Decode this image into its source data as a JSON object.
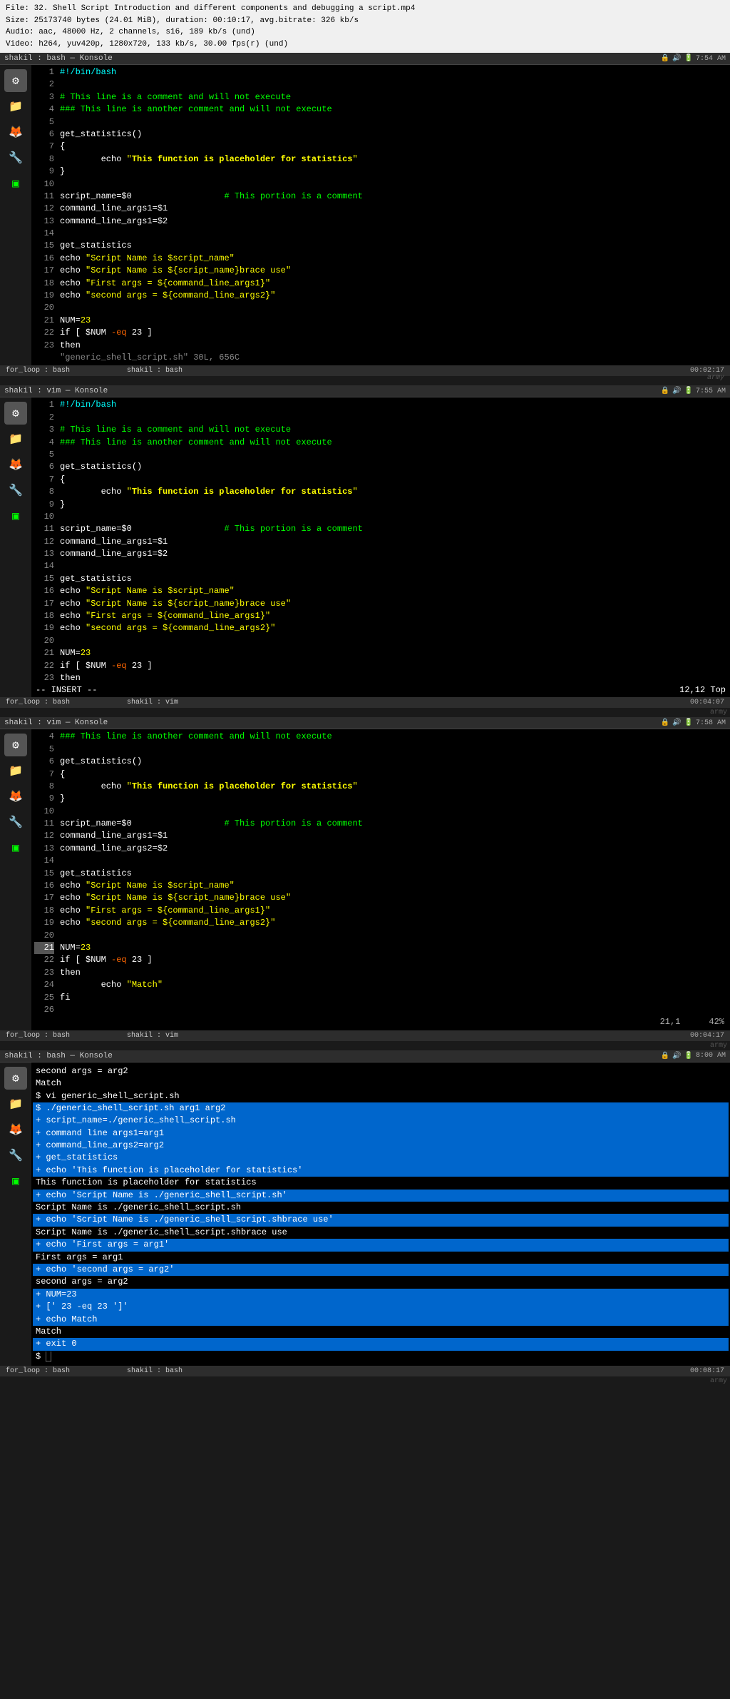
{
  "video": {
    "line1": "File: 32. Shell Script Introduction and different components and debugging a script.mp4",
    "line2": "Size: 25173740 bytes (24.01 MiB), duration: 00:10:17, avg.bitrate: 326 kb/s",
    "line3": "Audio: aac, 48000 Hz, 2 channels, s16, 189 kb/s (und)",
    "line4": "Video: h264, yuv420p, 1280x720, 133 kb/s, 30.00 fps(r) (und)"
  },
  "panels": [
    {
      "id": "panel1",
      "titlebar": "shakil : bash — Konsole",
      "timestamp": "7:54 AM",
      "mode": "bash",
      "statusbar_left": "for_loop : bash",
      "statusbar_right": "shakil : bash",
      "duration": "00:02:17"
    },
    {
      "id": "panel2",
      "titlebar": "shakil : vim — Konsole",
      "timestamp": "7:55 AM",
      "mode": "vim",
      "statusbar_left": "for_loop : bash",
      "statusbar_right": "shakil : vim",
      "duration": "00:04:07",
      "insert_mode": "-- INSERT --",
      "cursor_pos": "12,12",
      "scroll_pos": "Top"
    },
    {
      "id": "panel3",
      "titlebar": "shakil : vim — Konsole",
      "timestamp": "7:58 AM",
      "mode": "vim",
      "statusbar_left": "for_loop : bash",
      "statusbar_right": "shakil : vim",
      "duration": "00:04:17",
      "cursor_pos": "21,1",
      "scroll_pos": "42%"
    },
    {
      "id": "panel4",
      "titlebar": "shakil : bash — Konsole",
      "timestamp": "8:00 AM",
      "mode": "bash",
      "statusbar_left": "for_loop : bash",
      "statusbar_right": "shakil : bash",
      "duration": "00:08:17"
    }
  ],
  "code_block": {
    "shebang": "#!/bin/bash",
    "comment1": "# This line is a comment and will not execute",
    "comment2": "### This line is another comment and will not execute",
    "func_def": "get_statistics()",
    "brace_open": "{",
    "echo_func": "        echo \"This function is placeholder for statistics\"",
    "brace_close": "}",
    "script_name": "script_name=$0                  # This portion is a comment",
    "args1": "command_line_args1=$1",
    "args2": "command_line_args1=$2",
    "get_stats": "get_statistics",
    "echo1": "echo \"Script Name is $script_name\"",
    "echo2": "echo \"Script Name is ${script_name}brace use\"",
    "echo3": "echo \"First args = ${command_line_args1}\"",
    "echo4": "echo \"second args = ${command_line_args2}\"",
    "num": "NUM=23",
    "if_stmt": "if [ $NUM -eq 23 ]",
    "then": "then"
  },
  "bash_output": {
    "lines": [
      {
        "text": "second args = arg2",
        "highlight": false
      },
      {
        "text": "Match",
        "highlight": false
      },
      {
        "text": "$ vi generic_shell_script.sh",
        "highlight": false
      },
      {
        "text": "$ ./generic_shell_script.sh  arg1 arg2",
        "highlight": true
      },
      {
        "text": "+ script_name=./generic_shell_script.sh",
        "highlight": true
      },
      {
        "text": "+ command line args1=arg1",
        "highlight": true
      },
      {
        "text": "+ command_line_args2=arg2",
        "highlight": true
      },
      {
        "text": "+ get_statistics",
        "highlight": true
      },
      {
        "text": "+ echo 'This function is placeholder for statistics'",
        "highlight": true
      },
      {
        "text": "This function is placeholder for statistics",
        "highlight": false
      },
      {
        "text": "+ echo 'Script Name is ./generic_shell_script.sh'",
        "highlight": true
      },
      {
        "text": "Script Name is ./generic_shell_script.sh",
        "highlight": false
      },
      {
        "text": "+ echo 'Script Name is ./generic_shell_script.shbrace use'",
        "highlight": true
      },
      {
        "text": "Script Name is ./generic_shell_script.shbrace use",
        "highlight": false
      },
      {
        "text": "+ echo 'First args = arg1'",
        "highlight": true
      },
      {
        "text": "First args = arg1",
        "highlight": false
      },
      {
        "text": "+ echo 'second args = arg2'",
        "highlight": true
      },
      {
        "text": "second args = arg2",
        "highlight": false
      },
      {
        "text": "+ NUM=23",
        "highlight": true
      },
      {
        "text": "+ [' 23 -eq 23 ']'",
        "highlight": true
      },
      {
        "text": "+ echo Match",
        "highlight": true
      },
      {
        "text": "Match",
        "highlight": false
      },
      {
        "text": "+ exit 0",
        "highlight": true
      },
      {
        "text": "$ ▌",
        "highlight": false
      }
    ]
  }
}
